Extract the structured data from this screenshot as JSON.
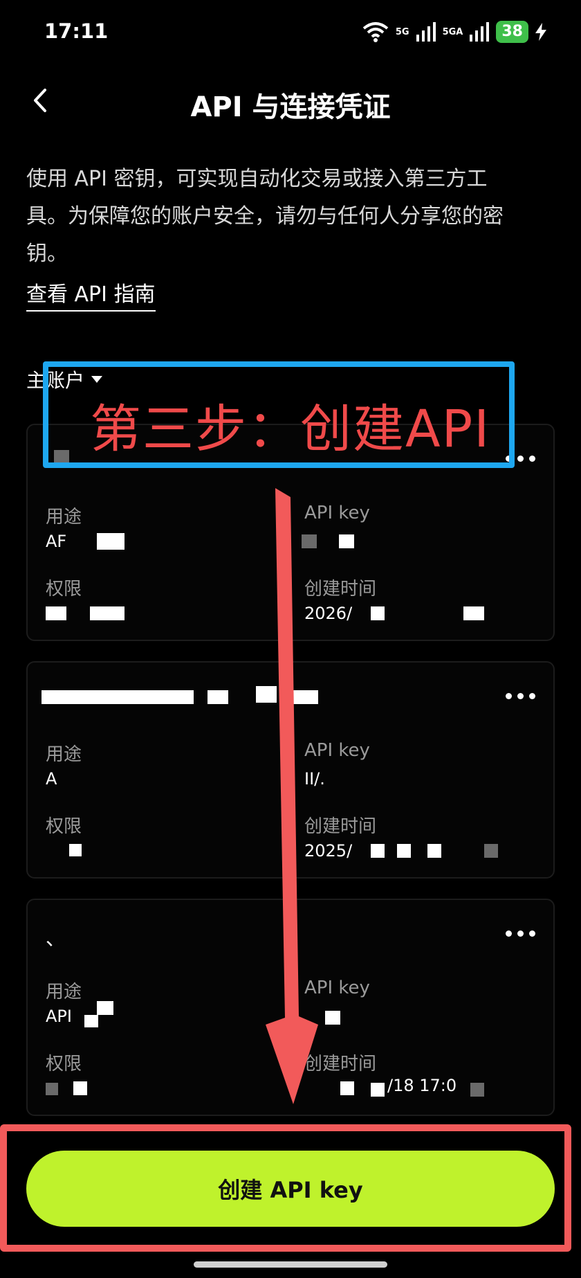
{
  "status_bar": {
    "time": "17:11",
    "network_1": "5G",
    "network_2": "5GA",
    "battery": "38"
  },
  "header": {
    "title": "API 与连接凭证"
  },
  "intro": {
    "line1": "使用 API 密钥，可实现自动化交易或接入第三方工",
    "line2": "具。为保障您的账户安全，请勿与任何人分享您的密",
    "line3": "钥。",
    "guide_link": "查看 API 指南"
  },
  "account_selector": {
    "label": "主账户"
  },
  "card_labels": {
    "usage": "用途",
    "api_key": "API key",
    "permission": "权限",
    "created_time": "创建时间"
  },
  "cards": [
    {
      "name": "",
      "usage": "AF",
      "api_key": "",
      "permission": "",
      "created_time": "2026/"
    },
    {
      "name": "",
      "usage": "A",
      "api_key": "II/.",
      "permission": "",
      "created_time": "2025/"
    },
    {
      "name": "、",
      "usage": "API",
      "api_key": "",
      "permission": "",
      "created_time": "/18 17:0"
    }
  ],
  "create_button": {
    "label": "创建 API key"
  },
  "annotations": {
    "step_text": "第三步：创建API",
    "blue_color": "#1ea7f0",
    "red_color": "#f25a5a"
  },
  "colors": {
    "accent": "#bff22c",
    "background": "#000000"
  }
}
